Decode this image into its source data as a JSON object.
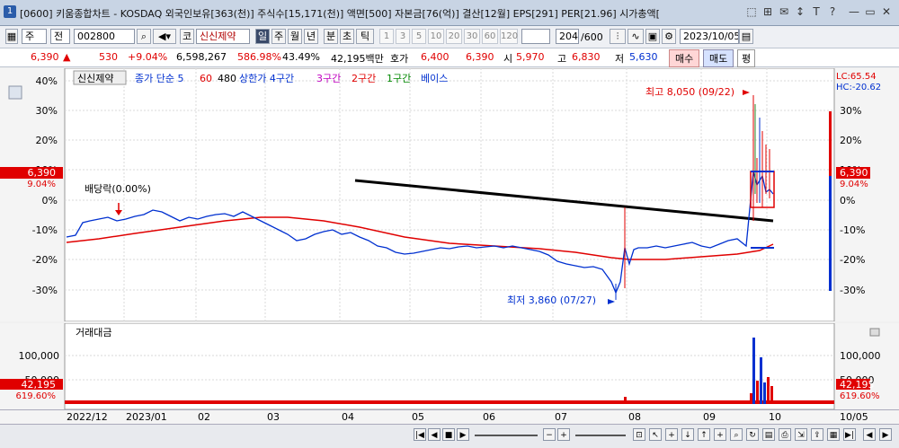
{
  "window": {
    "app_icon": "1",
    "title": "[0600] 키움종합차트 - KOSDAQ 외국인보유[363(천)] 주식수[15,171(천)] 액면[500] 자본금[76(억)] 결산[12월] EPS[291] PER[21.96] 시가총액[",
    "title_buttons": [
      "⬚",
      "⊞",
      "✉",
      "↕",
      "T",
      "?",
      "—",
      "▭",
      "✕"
    ]
  },
  "toolbar": {
    "period_prefix": "주",
    "period": "전",
    "stock_code": "002800",
    "market_badge": "코",
    "stock_name": "신신제약",
    "period_tabs": [
      "일",
      "주",
      "월",
      "년",
      "분",
      "초",
      "틱"
    ],
    "active_period": "일",
    "intervals": [
      "1",
      "3",
      "5",
      "10",
      "20",
      "30",
      "60",
      "120"
    ],
    "count_display": "204",
    "count_total": "/600",
    "date": "2023/10/05"
  },
  "price_row": {
    "price": "6,390",
    "change_arrow": "▲",
    "change": "530",
    "change_pct": "+9.04%",
    "volume": "6,598,267",
    "volume_ratio": "586.98%",
    "turnover": "43.49%",
    "amount": "42,195백만",
    "quote_label": "호가",
    "quote": "6,400",
    "current": "6,390",
    "open_label": "시",
    "open": "5,970",
    "high_label": "고",
    "high": "6,830",
    "low_label": "저",
    "low": "5,630",
    "buy_button": "매수",
    "sell_button": "매도",
    "flat_button": "평"
  },
  "main_chart": {
    "legend": {
      "name": "신신제약",
      "price_ma_label": "종가 단순 5",
      "ma60": "60",
      "ma480": "480",
      "upper_limit": "상한가 4구간",
      "zone3": "3구간",
      "zone2": "2구간",
      "zone1": "1구간",
      "base": "베이스"
    },
    "lc_label": "LC:65.54",
    "hc_label": "HC:-20.62",
    "left_price_tag": "6,390",
    "left_pct_tag": "9.04%",
    "right_price_tag": "6,390",
    "right_pct_tag": "9.04%",
    "y_ticks": [
      "40%",
      "30%",
      "20%",
      "10%",
      "0%",
      "-10%",
      "-20%",
      "-30%"
    ],
    "annotations": {
      "dividend": "배당락(0.00%)",
      "high": "최고 8,050 (09/22)",
      "low": "최저 3,860 (07/27)"
    },
    "colors": {
      "up": "#e00000",
      "down": "#0030d0",
      "ma60": "#e00000",
      "trend": "#000000"
    }
  },
  "volume_chart": {
    "label": "거래대금",
    "y_ticks": [
      "100,000",
      "50,000"
    ],
    "left_value_tag": "42,195",
    "left_pct_tag": "619.60%",
    "right_value_tag": "42,195",
    "right_pct_tag": "619.60%"
  },
  "x_axis": [
    "2022/12",
    "2023/01",
    "02",
    "03",
    "04",
    "05",
    "06",
    "07",
    "08",
    "09",
    "10",
    "10/05"
  ]
}
